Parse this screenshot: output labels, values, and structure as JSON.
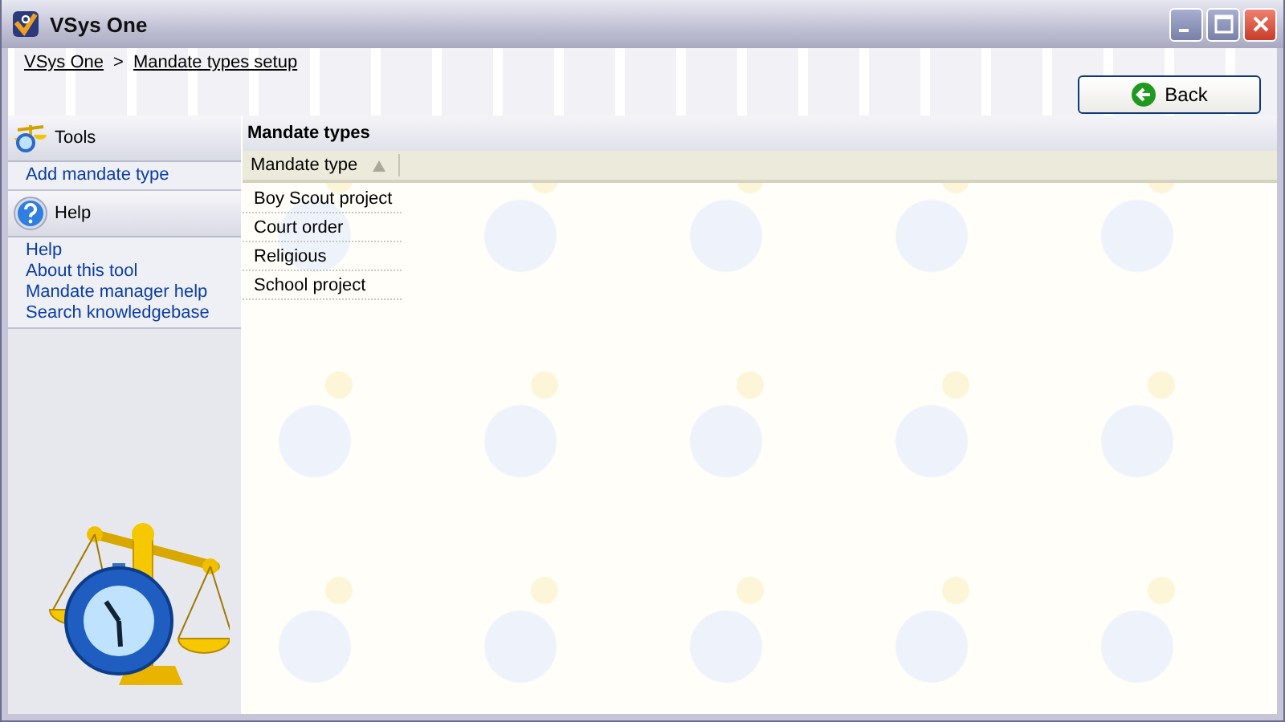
{
  "window": {
    "title": "VSys One"
  },
  "breadcrumb": [
    {
      "label": "VSys One"
    },
    {
      "label": "Mandate types setup"
    }
  ],
  "breadcrumb_separator": ">",
  "back_button": {
    "label": "Back"
  },
  "sidebar": {
    "sections": [
      {
        "kind": "tools",
        "title": "Tools",
        "items": [
          "Add mandate type"
        ]
      },
      {
        "kind": "help",
        "title": "Help",
        "items": [
          "Help",
          "About this tool",
          "Mandate manager help",
          "Search knowledgebase"
        ]
      }
    ]
  },
  "panel": {
    "title": "Mandate types"
  },
  "table": {
    "columns": [
      {
        "label": "Mandate type",
        "sorted": true
      }
    ],
    "rows": [
      "Boy Scout project",
      "Court order",
      "Religious",
      "School project"
    ]
  }
}
